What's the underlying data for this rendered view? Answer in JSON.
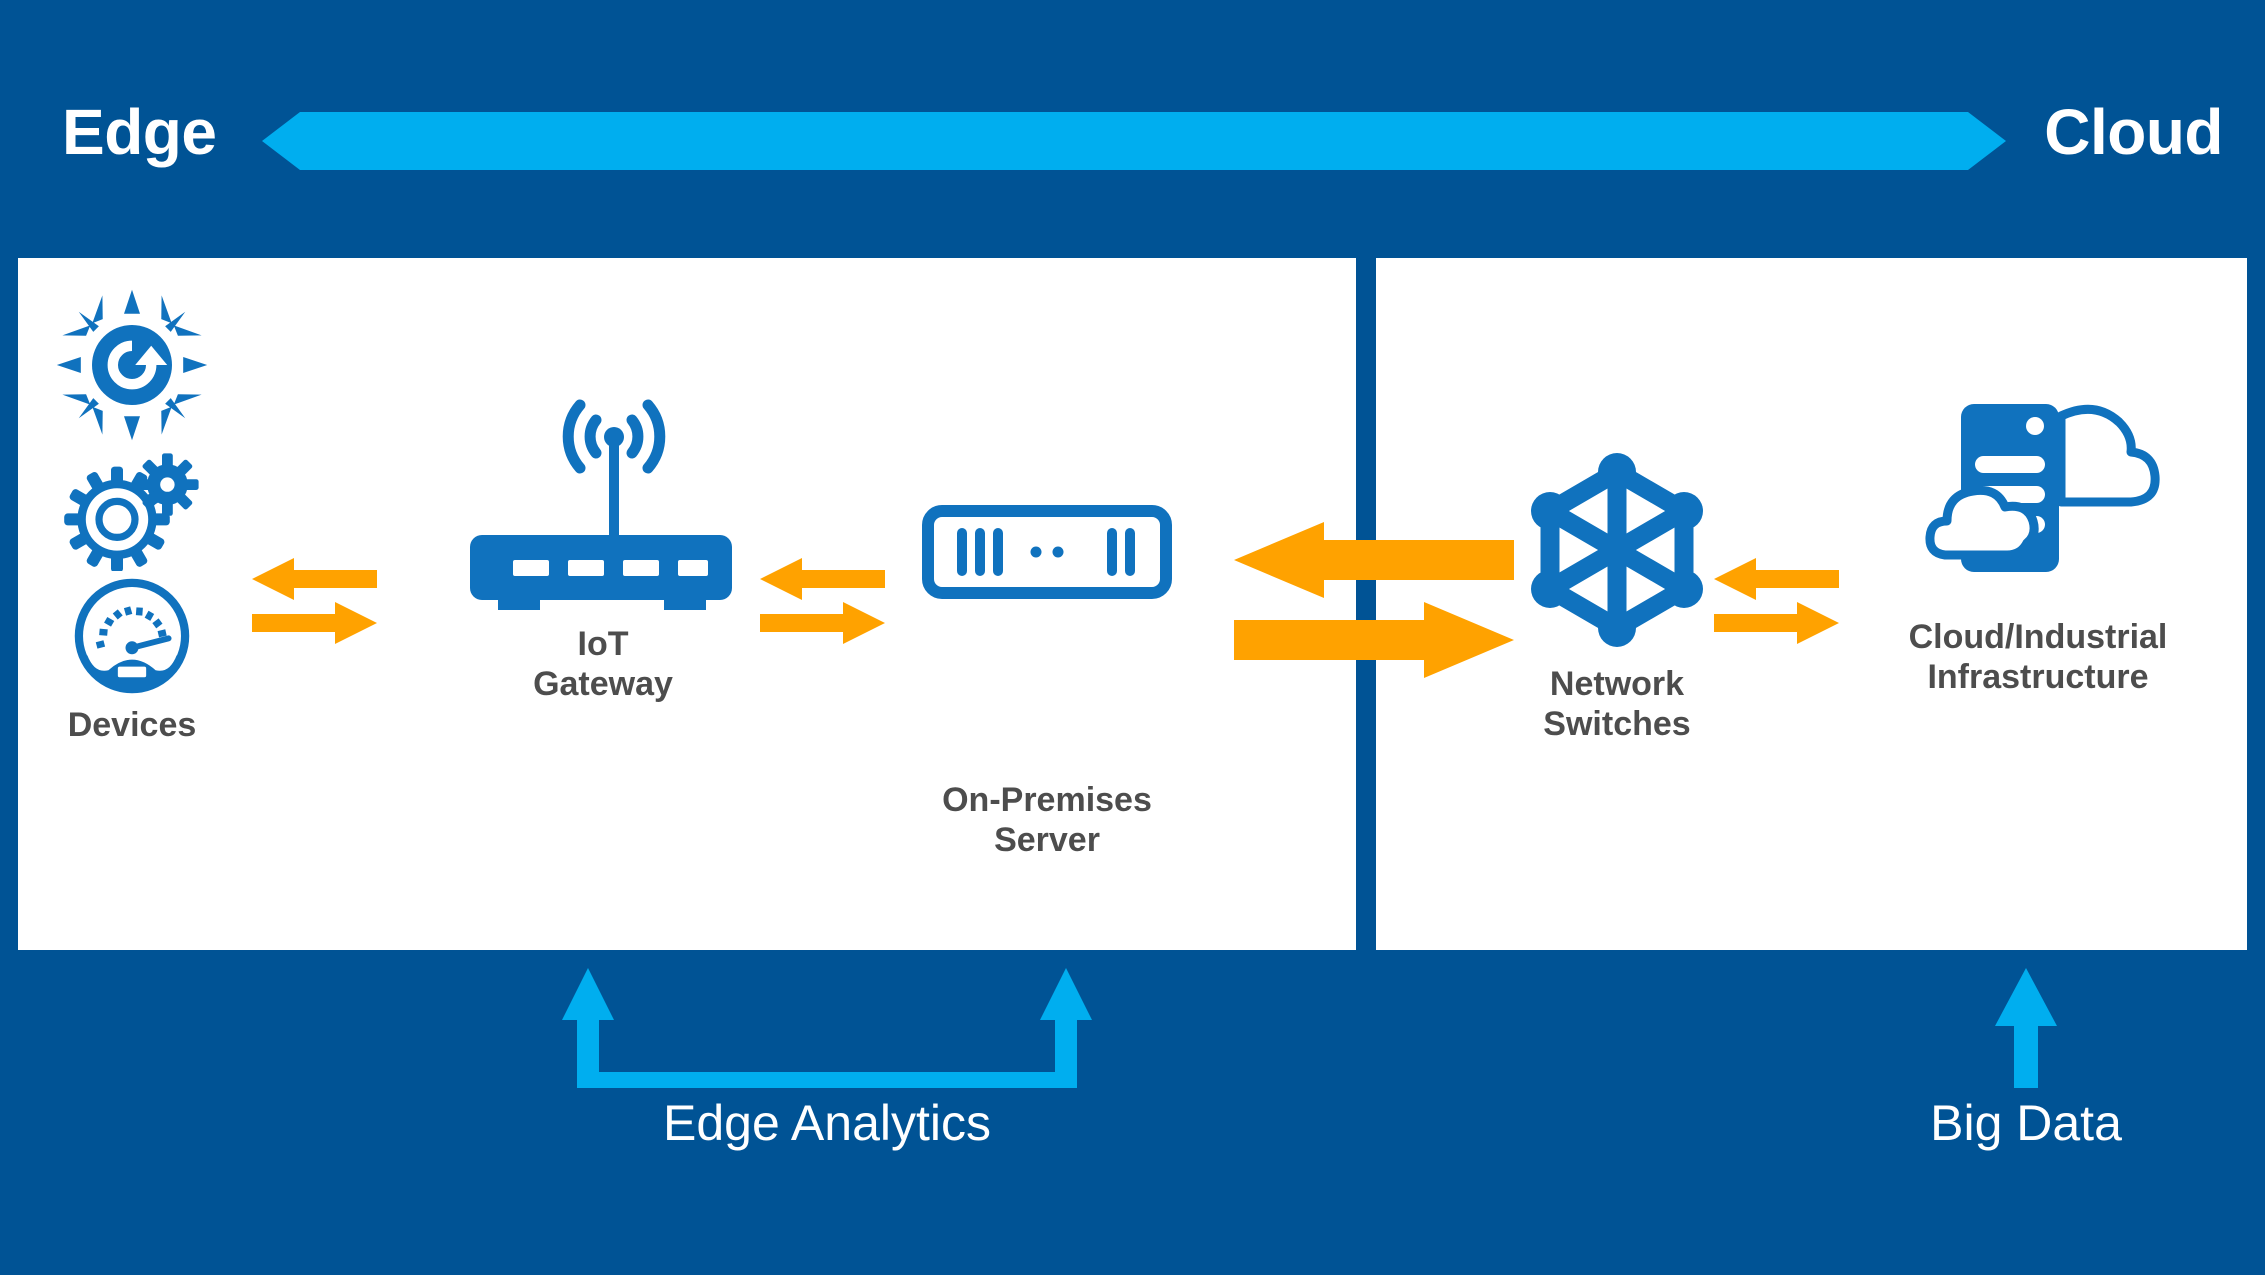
{
  "page": {
    "background_color": "#005395",
    "panel_color": "#ffffff",
    "accent_light_blue": "#00AEEF",
    "accent_orange": "#FFA200",
    "icon_blue": "#1072BE",
    "label_gray": "#4D4D4D"
  },
  "header": {
    "edge_label": "Edge",
    "cloud_label": "Cloud",
    "spectrum_arrow_icon": "double-headed-horizontal-arrow-icon",
    "spectrum_arrow_color": "#00AEEF"
  },
  "panels": {
    "left_name": "edge-zone-panel",
    "right_name": "cloud-zone-panel",
    "divider_color": "#005395"
  },
  "nodes": [
    {
      "id": "devices",
      "label": "Devices",
      "icons": [
        "sensor-refresh-icon",
        "gears-icon",
        "gauge-icon"
      ]
    },
    {
      "id": "gateway",
      "label": "IoT\nGateway",
      "icons": [
        "wireless-router-icon"
      ]
    },
    {
      "id": "server",
      "label": "On-Premises\nServer",
      "icons": [
        "rack-server-icon"
      ]
    },
    {
      "id": "switches",
      "label": "Network\nSwitches",
      "icons": [
        "network-mesh-icon"
      ]
    },
    {
      "id": "cloud",
      "label": "Cloud/Industrial\nInfrastructure",
      "icons": [
        "server-cloud-icon"
      ]
    }
  ],
  "connectors": [
    {
      "id": "devices-to-gateway",
      "icon": "bidirectional-exchange-arrows-icon",
      "color": "#FFA200",
      "size": "small"
    },
    {
      "id": "gateway-to-server",
      "icon": "bidirectional-exchange-arrows-icon",
      "color": "#FFA200",
      "size": "small"
    },
    {
      "id": "server-to-switches",
      "icon": "bidirectional-exchange-arrows-icon",
      "color": "#FFA200",
      "size": "large"
    },
    {
      "id": "switches-to-cloud",
      "icon": "bidirectional-exchange-arrows-icon",
      "color": "#FFA200",
      "size": "small"
    }
  ],
  "annotations": [
    {
      "id": "edge-analytics",
      "label": "Edge Analytics",
      "icon": "bracket-up-arrows-icon",
      "color": "#00AEEF",
      "spans": [
        "gateway",
        "server"
      ]
    },
    {
      "id": "big-data",
      "label": "Big Data",
      "icon": "up-arrow-icon",
      "color": "#00AEEF",
      "spans": [
        "cloud"
      ]
    }
  ]
}
